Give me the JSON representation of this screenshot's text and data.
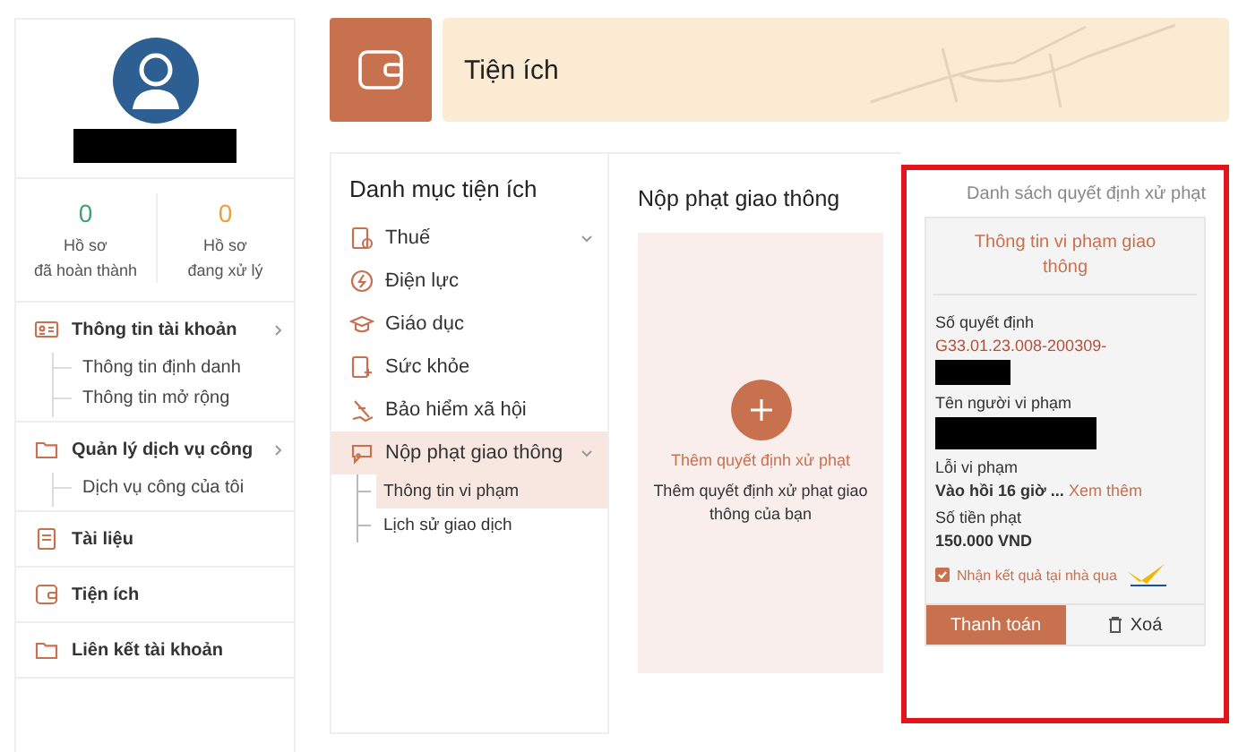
{
  "profile": {
    "redacted": true
  },
  "stats": [
    {
      "count": "0",
      "label": "Hồ sơ",
      "sublabel": "đã hoàn thành",
      "color": "#3aa66b"
    },
    {
      "count": "0",
      "label": "Hồ sơ",
      "sublabel": "đang xử lý",
      "color": "#f0a030"
    }
  ],
  "sidebar_menu": [
    {
      "label": "Thông tin tài khoản",
      "expandable": true,
      "children": [
        {
          "label": "Thông tin định danh"
        },
        {
          "label": "Thông tin mở rộng"
        }
      ]
    },
    {
      "label": "Quản lý dịch vụ công",
      "expandable": true,
      "children": [
        {
          "label": "Dịch vụ công của tôi"
        }
      ]
    },
    {
      "label": "Tài liệu",
      "expandable": false
    },
    {
      "label": "Tiện ích",
      "expandable": false
    },
    {
      "label": "Liên kết tài khoản",
      "expandable": false
    }
  ],
  "header": {
    "title": "Tiện ích"
  },
  "categories": {
    "title": "Danh mục tiện ích",
    "items": [
      {
        "label": "Thuế",
        "selected": false,
        "expandable": true
      },
      {
        "label": "Điện lực",
        "selected": false,
        "expandable": false
      },
      {
        "label": "Giáo dục",
        "selected": false,
        "expandable": false
      },
      {
        "label": "Sức khỏe",
        "selected": false,
        "expandable": false
      },
      {
        "label": "Bảo hiểm xã hội",
        "selected": false,
        "expandable": false
      },
      {
        "label": "Nộp phạt giao thông",
        "selected": true,
        "expandable": true,
        "children": [
          {
            "label": "Thông tin vi phạm",
            "selected": true
          },
          {
            "label": "Lịch sử giao dịch",
            "selected": false
          }
        ]
      }
    ]
  },
  "traffic_fine": {
    "title": "Nộp phạt giao thông",
    "add_card": {
      "action": "Thêm quyết định xử phạt",
      "description": "Thêm quyết định xử phạt giao thông của bạn"
    }
  },
  "decisions": {
    "title": "Danh sách quyết định xử phạt",
    "highlighted": true,
    "card": {
      "title": "Thông tin vi phạm giao thông",
      "fields": [
        {
          "label": "Số quyết định",
          "value": "G33.01.23.008-200309-",
          "accent": true,
          "redacted": true
        },
        {
          "label": "Tên người vi phạm",
          "redacted": true
        },
        {
          "label": "Lỗi vi phạm",
          "value": "Vào hồi 16 giờ ...",
          "link": "Xem thêm",
          "accent": false,
          "redacted": false
        },
        {
          "label": "Số tiền phạt",
          "value": "150.000 VND",
          "accent": false,
          "redacted": false
        }
      ],
      "delivery": {
        "label": "Nhận kết quả tại nhà qua",
        "checked": true
      },
      "buttons": [
        {
          "label": "Thanh toán",
          "kind": "primary"
        },
        {
          "label": "Xoá",
          "kind": "delete"
        }
      ]
    }
  }
}
